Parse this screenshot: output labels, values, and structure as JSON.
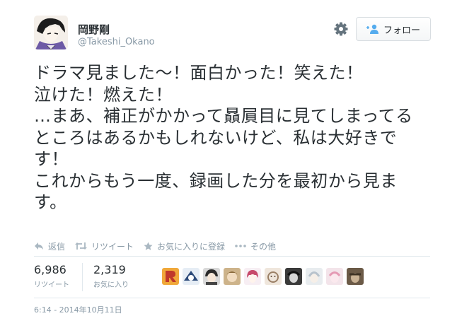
{
  "user": {
    "display_name": "岡野剛",
    "handle": "@Takeshi_Okano"
  },
  "follow_button": {
    "label": "フォロー"
  },
  "tweet": {
    "text": "ドラマ見ました〜！面白かった！笑えた！\n泣けた！燃えた！\n…まあ、補正がかかって贔屓目に見てしまってるところはあるかもしれないけど、私は大好きです！\nこれからもう一度、録画した分を最初から見ます。"
  },
  "actions": {
    "reply": "返信",
    "retweet": "リツイート",
    "favorite": "お気に入りに登録",
    "more": "その他"
  },
  "stats": {
    "retweets": {
      "value": "6,986",
      "label": "リツイート"
    },
    "favorites": {
      "value": "2,319",
      "label": "お気に入り"
    }
  },
  "timestamp": "6:14 - 2014年10月11日",
  "colors": {
    "text": "#292f33",
    "muted": "#8899a6",
    "border": "#e1e8ed",
    "follow_icon": "#55acee"
  },
  "icons": [
    "gear-icon",
    "add-user-icon",
    "reply-icon",
    "retweet-icon",
    "star-icon",
    "more-dots-icon"
  ]
}
